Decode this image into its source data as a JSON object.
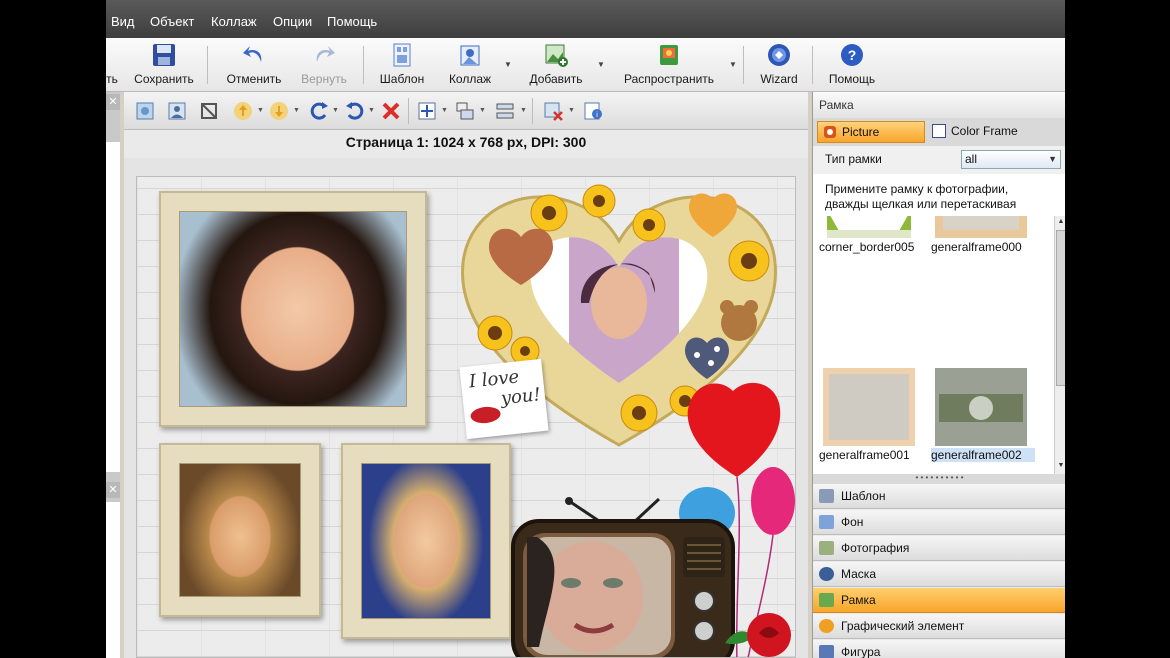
{
  "menu": {
    "items": [
      "Вид",
      "Объект",
      "Коллаж",
      "Опции",
      "Помощь"
    ]
  },
  "toolbar": {
    "clipped_label": "ть",
    "save": "Сохранить",
    "undo": "Отменить",
    "redo": "Вернуть",
    "template": "Шаблон",
    "collage": "Коллаж",
    "add": "Добавить",
    "distribute": "Распространить",
    "wizard": "Wizard",
    "help": "Помощь"
  },
  "page_info": "Страница 1: 1024 x 768 px, DPI: 300",
  "canvas": {
    "love_note_line1": "I love",
    "love_note_line2": "you!"
  },
  "panel": {
    "title": "Рамка",
    "tabs": {
      "picture_frame": "Picture Frame",
      "color_frame": "Color Frame"
    },
    "frame_type_label": "Тип рамки",
    "frame_type_value": "all",
    "hint_line1": "Примените рамку к фотографии,",
    "hint_line2": "дважды щелкая или перетаскивая",
    "thumbs": [
      {
        "name": "corner_border005"
      },
      {
        "name": "generalframe000"
      },
      {
        "name": "generalframe001"
      },
      {
        "name": "generalframe002"
      }
    ],
    "sections": [
      {
        "label": "Шаблон",
        "icon": "template-icon"
      },
      {
        "label": "Фон",
        "icon": "background-icon"
      },
      {
        "label": "Фотография",
        "icon": "photo-icon"
      },
      {
        "label": "Маска",
        "icon": "mask-icon"
      },
      {
        "label": "Рамка",
        "icon": "frame-icon",
        "active": true
      },
      {
        "label": "Графический элемент",
        "icon": "clipart-icon"
      },
      {
        "label": "Фигура",
        "icon": "shape-icon"
      }
    ]
  },
  "colors": {
    "accent": "#f9a52c",
    "menubar": "#4a4a4a"
  }
}
